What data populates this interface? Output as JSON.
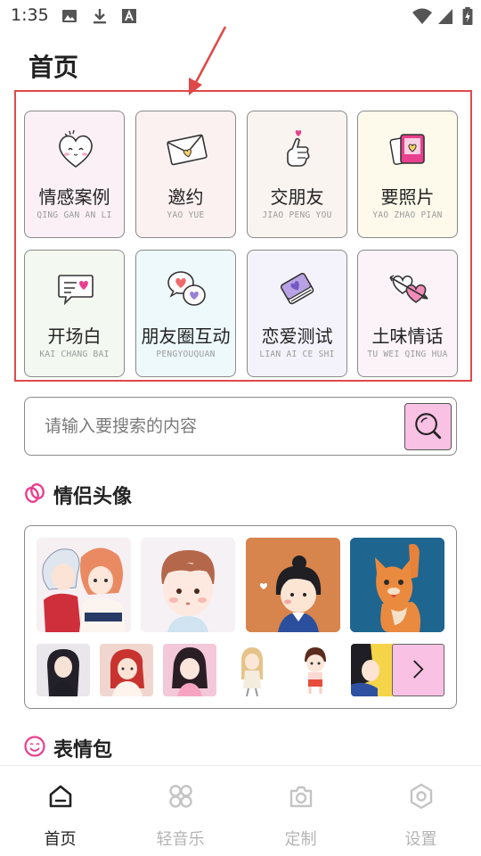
{
  "status_bar": {
    "time": "1:35",
    "left_icons": [
      "image-icon",
      "download-icon",
      "font-icon"
    ],
    "right_icons": [
      "wifi-icon",
      "signal-icon",
      "battery-icon"
    ]
  },
  "page": {
    "title": "首页"
  },
  "categories": [
    {
      "label": "情感案例",
      "pinyin": "QING GAN AN LI",
      "icon": "heart-face-icon",
      "bg": "#fbf0f5"
    },
    {
      "label": "邀约",
      "pinyin": "YAO YUE",
      "icon": "envelope-heart-icon",
      "bg": "#fbf1f1"
    },
    {
      "label": "交朋友",
      "pinyin": "JIAO PENG YOU",
      "icon": "finger-heart-icon",
      "bg": "#faf4f0"
    },
    {
      "label": "要照片",
      "pinyin": "YAO ZHAO PIAN",
      "icon": "photo-cards-icon",
      "bg": "#fdfaeb"
    },
    {
      "label": "开场白",
      "pinyin": "KAI CHANG BAI",
      "icon": "chat-bubble-heart-icon",
      "bg": "#f3f9f1"
    },
    {
      "label": "朋友圈互动",
      "pinyin": "PENGYOUQUAN",
      "icon": "chat-hearts-icon",
      "bg": "#eef9fb"
    },
    {
      "label": "恋爱测试",
      "pinyin": "LIAN AI CE SHI",
      "icon": "book-heart-icon",
      "bg": "#f4f3fb"
    },
    {
      "label": "土味情话",
      "pinyin": "TU WEI QING HUA",
      "icon": "arrow-hearts-icon",
      "bg": "#fbf3f7"
    }
  ],
  "search": {
    "placeholder": "请输入要搜索的内容",
    "value": ""
  },
  "sections": {
    "couple_avatars": {
      "title": "情侣头像",
      "icon": "couple-rings-icon"
    },
    "stickers": {
      "title": "表情包",
      "icon": "smiley-icon"
    }
  },
  "bottom_nav": [
    {
      "label": "首页",
      "icon": "home-icon",
      "active": true
    },
    {
      "label": "轻音乐",
      "icon": "grid-circles-icon",
      "active": false
    },
    {
      "label": "定制",
      "icon": "camera-icon",
      "active": false
    },
    {
      "label": "设置",
      "icon": "settings-icon",
      "active": false
    }
  ],
  "colors": {
    "accent_pink": "#f9c1e3",
    "annotation_red": "#e04848",
    "icon_pink": "#e83f8e",
    "icon_purple": "#9b80d8"
  }
}
